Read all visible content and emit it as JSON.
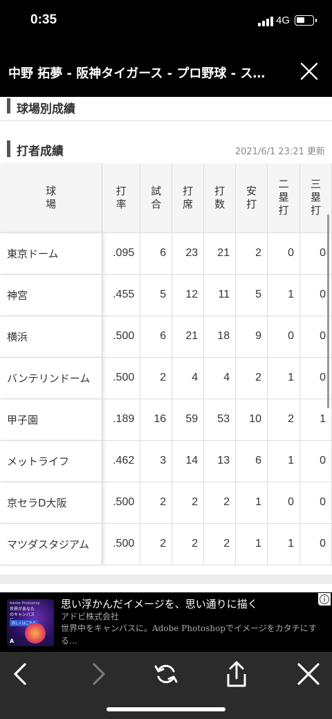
{
  "status_bar": {
    "time": "0:35",
    "network": "4G"
  },
  "header": {
    "title": "中野 拓夢 - 阪神タイガース - プロ野球 - ス…"
  },
  "sections": {
    "venue_stats": "球場別成績",
    "batter_stats": "打者成績"
  },
  "updated": "2021/6/1 23:21 更新",
  "table": {
    "columns": [
      "球場",
      "打率",
      "試合",
      "打席",
      "打数",
      "安打",
      "二塁打",
      "三塁打"
    ],
    "rows": [
      [
        "東京ドーム",
        ".095",
        "6",
        "23",
        "21",
        "2",
        "0",
        "0"
      ],
      [
        "神宮",
        ".455",
        "5",
        "12",
        "11",
        "5",
        "1",
        "0"
      ],
      [
        "横浜",
        ".500",
        "6",
        "21",
        "18",
        "9",
        "0",
        "0"
      ],
      [
        "バンテリンドーム",
        ".500",
        "2",
        "4",
        "4",
        "2",
        "1",
        "0"
      ],
      [
        "甲子園",
        ".189",
        "16",
        "59",
        "53",
        "10",
        "2",
        "1"
      ],
      [
        "メットライフ",
        ".462",
        "3",
        "14",
        "13",
        "6",
        "1",
        "0"
      ],
      [
        "京セラD大阪",
        ".500",
        "2",
        "2",
        "2",
        "1",
        "0",
        "0"
      ],
      [
        "マツダスタジアム",
        ".500",
        "2",
        "2",
        "2",
        "1",
        "1",
        "0"
      ]
    ]
  },
  "ad": {
    "title": "思い浮かんだイメージを、思い通りに描く",
    "company": "アドビ株式会社",
    "description": "世界中をキャンバスに。Adobe Photoshopでイメージをカタチにする…",
    "thumb_brand": "Adobe Photoshop",
    "thumb_headline": "世界があなたのキャンバスに",
    "thumb_cta": "詳しくはこちら",
    "thumb_logo": "A"
  },
  "toolbar": {
    "icons": [
      "back-arrow-icon",
      "forward-arrow-icon",
      "reload-icon",
      "share-icon",
      "close-icon"
    ]
  },
  "colors": {
    "header_bg": "#000000",
    "toolbar_bg": "#2b2b2b",
    "table_header_bg": "#f5f5f5",
    "section_bar": "#555555"
  }
}
